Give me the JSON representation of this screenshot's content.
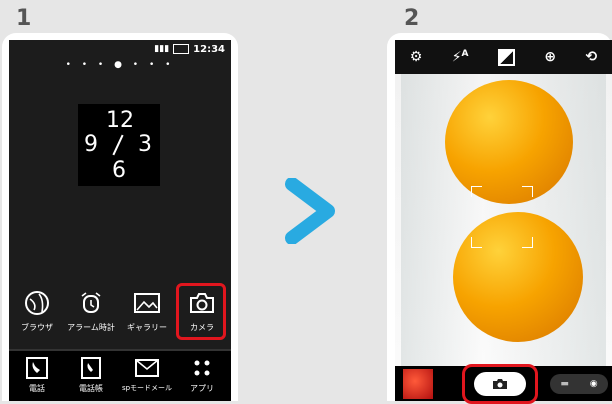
{
  "steps": {
    "one": "1",
    "two": "2"
  },
  "phone1": {
    "status_time": "12:34",
    "page_dots": "• • • ● • • •",
    "clock": {
      "h1": "12",
      "h2": "9",
      "h3": "3",
      "h4": "6"
    },
    "apps": [
      {
        "label": "ブラウザ",
        "icon": "globe-icon"
      },
      {
        "label": "アラーム時計",
        "icon": "alarm-clock-icon"
      },
      {
        "label": "ギャラリー",
        "icon": "gallery-icon"
      },
      {
        "label": "カメラ",
        "icon": "camera-icon"
      }
    ],
    "dock": [
      {
        "label": "電話",
        "icon": "phone-icon"
      },
      {
        "label": "電話帳",
        "icon": "contacts-icon"
      },
      {
        "label": "spモードメール",
        "icon": "mail-icon"
      },
      {
        "label": "アプリ",
        "icon": "apps-grid-icon"
      }
    ],
    "highlight_color": "#e1161e"
  },
  "phone2": {
    "toolbar": [
      "settings-icon",
      "flash-auto-icon",
      "exposure-icon",
      "zoom-icon",
      "switch-camera-icon"
    ],
    "flash_label": "A",
    "accent": "#29aae1"
  }
}
